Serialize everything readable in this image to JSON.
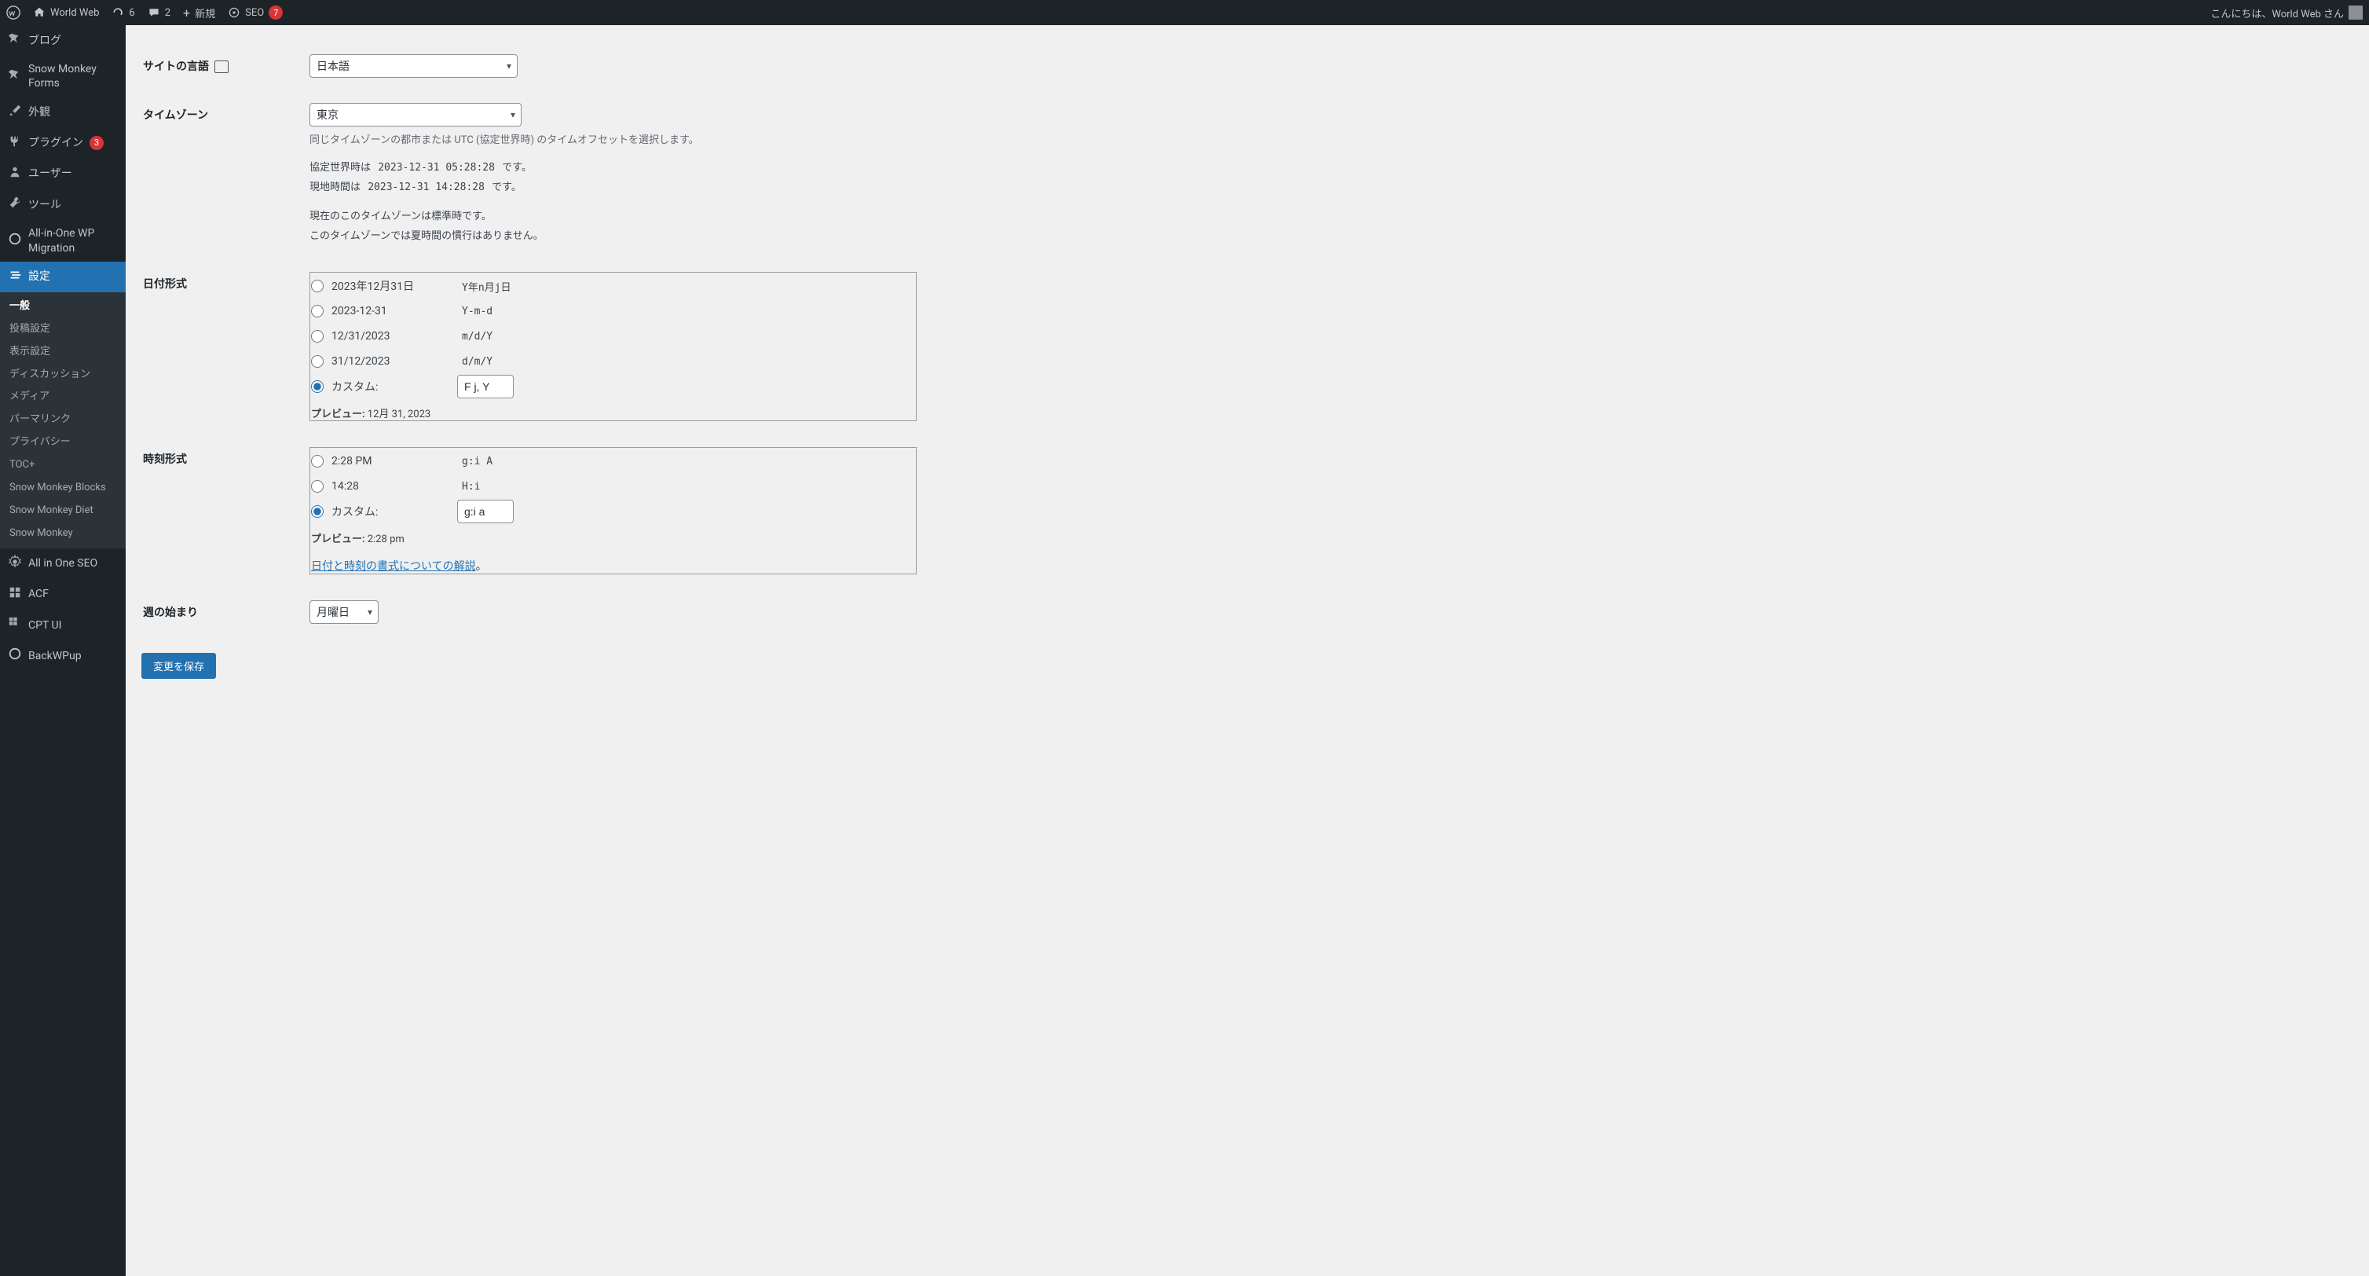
{
  "adminbar": {
    "site_name": "World Web",
    "updates": "6",
    "comments": "2",
    "new_label": "新規",
    "seo_label": "SEO",
    "seo_count": "7",
    "greeting": "こんにちは、World Web さん"
  },
  "sidebar": {
    "items": [
      {
        "label": "ブログ",
        "icon": "pin"
      },
      {
        "label": "Snow Monkey Forms",
        "icon": "pin"
      },
      {
        "label": "外観",
        "icon": "brush"
      },
      {
        "label": "プラグイン",
        "icon": "plug",
        "count": "3"
      },
      {
        "label": "ユーザー",
        "icon": "user"
      },
      {
        "label": "ツール",
        "icon": "tool"
      },
      {
        "label": "All-in-One WP Migration",
        "icon": "circle"
      },
      {
        "label": "設定",
        "icon": "settings",
        "current": true
      },
      {
        "label": "All in One SEO",
        "icon": "gear"
      },
      {
        "label": "ACF",
        "icon": "grid"
      },
      {
        "label": "CPT UI",
        "icon": "squares"
      },
      {
        "label": "BackWPup",
        "icon": "circle"
      }
    ],
    "submenu": [
      "一般",
      "投稿設定",
      "表示設定",
      "ディスカッション",
      "メディア",
      "パーマリンク",
      "プライバシー",
      "TOC+",
      "Snow Monkey Blocks",
      "Snow Monkey Diet",
      "Snow Monkey"
    ]
  },
  "form": {
    "site_language": {
      "label": "サイトの言語",
      "value": "日本語"
    },
    "timezone": {
      "label": "タイムゾーン",
      "value": "東京",
      "desc": "同じタイムゾーンの都市または UTC (協定世界時) のタイムオフセットを選択します。",
      "utc_prefix": "協定世界時は ",
      "utc_value": "2023-12-31 05:28:28",
      "utc_suffix": " です。",
      "local_prefix": "現地時間は ",
      "local_value": "2023-12-31 14:28:28",
      "local_suffix": " です。",
      "std_line": "現在のこのタイムゾーンは標準時です。",
      "dst_line": "このタイムゾーンでは夏時間の慣行はありません。"
    },
    "date_format": {
      "label": "日付形式",
      "options": [
        {
          "example": "2023年12月31日",
          "code": "Y年n月j日"
        },
        {
          "example": "2023-12-31",
          "code": "Y-m-d"
        },
        {
          "example": "12/31/2023",
          "code": "m/d/Y"
        },
        {
          "example": "31/12/2023",
          "code": "d/m/Y"
        }
      ],
      "custom_label": "カスタム:",
      "custom_value": "F j, Y",
      "preview_label": "プレビュー:",
      "preview_value": "12月 31, 2023"
    },
    "time_format": {
      "label": "時刻形式",
      "options": [
        {
          "example": "2:28 PM",
          "code": "g:i A"
        },
        {
          "example": "14:28",
          "code": "H:i"
        }
      ],
      "custom_label": "カスタム:",
      "custom_value": "g:i a",
      "preview_label": "プレビュー:",
      "preview_value": "2:28 pm",
      "doc_link": "日付と時刻の書式についての解説",
      "doc_suffix": "。"
    },
    "week_start": {
      "label": "週の始まり",
      "value": "月曜日"
    },
    "submit": "変更を保存"
  }
}
